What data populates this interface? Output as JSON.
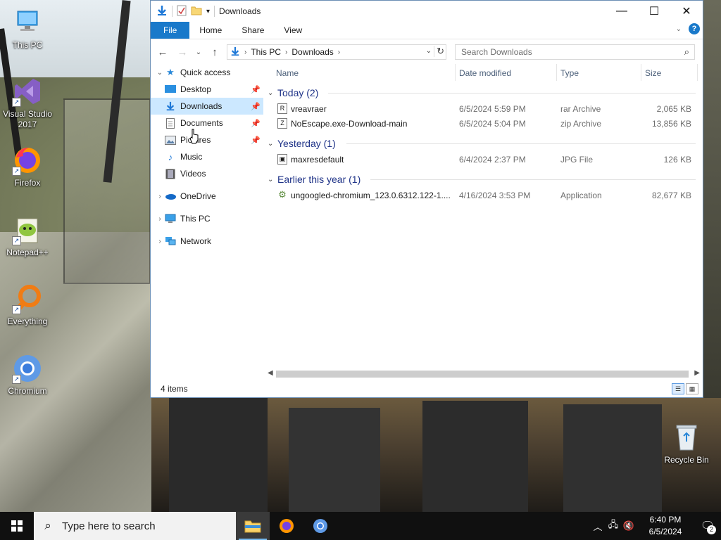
{
  "desktop": {
    "icons": [
      {
        "label": "This PC",
        "icon": "this-pc-icon"
      },
      {
        "label": "Visual Studio 2017",
        "icon": "visual-studio-icon"
      },
      {
        "label": "Firefox",
        "icon": "firefox-icon"
      },
      {
        "label": "Notepad++",
        "icon": "notepadpp-icon"
      },
      {
        "label": "Everything",
        "icon": "everything-icon"
      },
      {
        "label": "Chromium",
        "icon": "chromium-icon"
      },
      {
        "label": "Recycle Bin",
        "icon": "recycle-bin-icon"
      }
    ]
  },
  "explorer": {
    "title": "Downloads",
    "ribbon": {
      "tabs": [
        "File",
        "Home",
        "Share",
        "View"
      ],
      "help": "?"
    },
    "address": {
      "crumbs": [
        "This PC",
        "Downloads"
      ]
    },
    "search": {
      "placeholder": "Search Downloads"
    },
    "nav": {
      "quick_access": "Quick access",
      "items": [
        {
          "label": "Desktop",
          "pinned": true
        },
        {
          "label": "Downloads",
          "pinned": true,
          "selected": true
        },
        {
          "label": "Documents",
          "pinned": true
        },
        {
          "label": "Pictures",
          "pinned": true
        },
        {
          "label": "Music",
          "pinned": false
        },
        {
          "label": "Videos",
          "pinned": false
        }
      ],
      "onedrive": "OneDrive",
      "this_pc": "This PC",
      "network": "Network"
    },
    "columns": {
      "name": "Name",
      "date": "Date modified",
      "type": "Type",
      "size": "Size"
    },
    "groups": [
      {
        "label": "Today (2)",
        "files": [
          {
            "name": "vreavraer",
            "date": "6/5/2024 5:59 PM",
            "type": "rar Archive",
            "size": "2,065 KB",
            "glyph": "R"
          },
          {
            "name": "NoEscape.exe-Download-main",
            "date": "6/5/2024 5:04 PM",
            "type": "zip Archive",
            "size": "13,856 KB",
            "glyph": "Z"
          }
        ]
      },
      {
        "label": "Yesterday (1)",
        "files": [
          {
            "name": "maxresdefault",
            "date": "6/4/2024 2:37 PM",
            "type": "JPG File",
            "size": "126 KB",
            "glyph": "▣"
          }
        ]
      },
      {
        "label": "Earlier this year (1)",
        "files": [
          {
            "name": "ungoogled-chromium_123.0.6312.122-1....",
            "date": "4/16/2024 3:53 PM",
            "type": "Application",
            "size": "82,677 KB",
            "glyph": "⚙"
          }
        ]
      }
    ],
    "status": "4 items"
  },
  "taskbar": {
    "search_placeholder": "Type here to search",
    "time": "6:40 PM",
    "date": "6/5/2024",
    "notification_count": "2"
  }
}
